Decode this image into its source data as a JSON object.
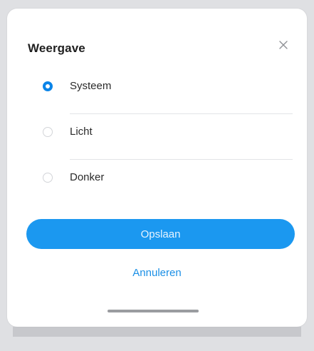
{
  "dialog": {
    "title": "Weergave",
    "close_icon": "close-icon",
    "options": [
      {
        "label": "Systeem",
        "selected": true
      },
      {
        "label": "Licht",
        "selected": false
      },
      {
        "label": "Donker",
        "selected": false
      }
    ],
    "save_label": "Opslaan",
    "cancel_label": "Annuleren"
  },
  "colors": {
    "accent": "#1b98f0",
    "radio_checked": "#0a84e8",
    "link": "#1a8fe6"
  }
}
